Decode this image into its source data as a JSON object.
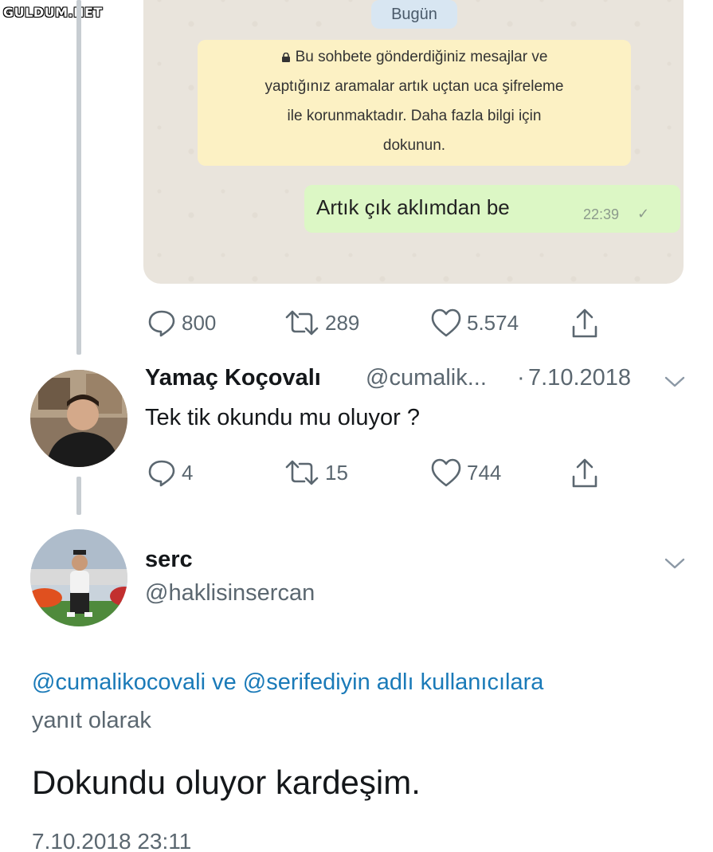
{
  "watermark": "GULDUM.NET",
  "chat": {
    "date_chip": "Bugün",
    "notice_lines": [
      "Bu sohbete gönderdiğiniz mesajlar ve",
      "yaptığınız aramalar artık uçtan uca şifreleme",
      "ile korunmaktadır. Daha fazla bilgi için",
      "dokunun."
    ],
    "message": {
      "text": "Artık çık aklımdan be",
      "time": "22:39",
      "status": "✓"
    }
  },
  "tweet1_actions": {
    "replies": "800",
    "retweets": "289",
    "likes": "5.574"
  },
  "tweet2": {
    "name": "Yamaç Koçovalı",
    "handle": "@cumalik...",
    "separator": "·",
    "date": "7.10.2018",
    "text": "Tek tik okundu mu oluyor ?",
    "actions": {
      "replies": "4",
      "retweets": "15",
      "likes": "744"
    }
  },
  "tweet3": {
    "name": "serc",
    "handle": "@haklisinsercan",
    "reply_to": "@cumalikocovali ve @serifediyin adlı kullanıcılara",
    "reply_to_suffix": "yanıt olarak",
    "text": "Dokundu oluyor kardeşim.",
    "timestamp": "7.10.2018 23:11"
  },
  "colors": {
    "link": "#1a7ab8",
    "muted": "#5b6770",
    "chat_bg": "#e9e4dc",
    "bubble": "#dcf7c5",
    "notice": "#fcf1c4"
  }
}
